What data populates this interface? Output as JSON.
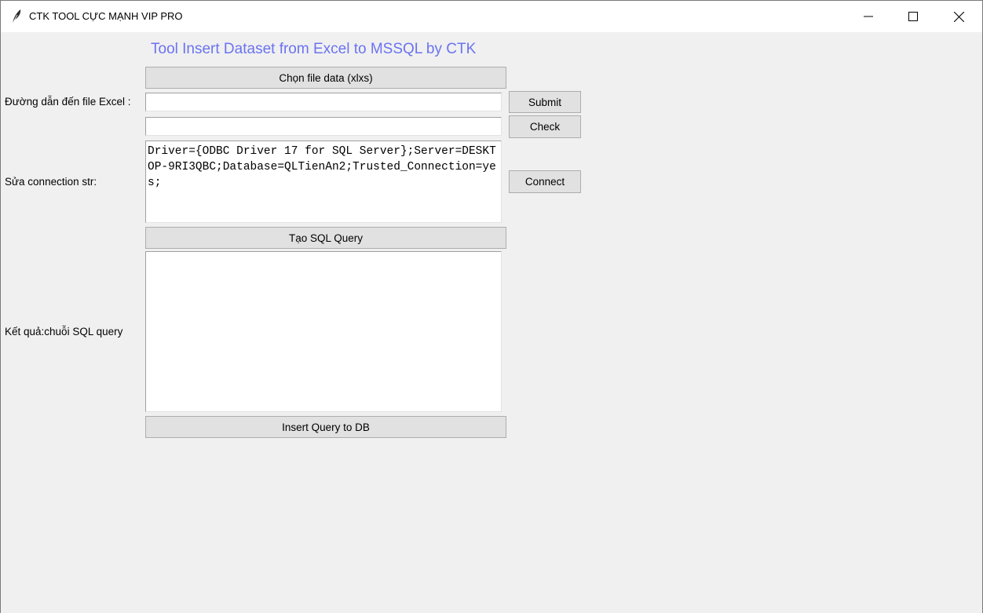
{
  "window": {
    "title": "CTK TOOL CỰC MẠNH VIP PRO",
    "icon": "feather-icon",
    "controls": {
      "minimize_icon": "minimize-icon",
      "maximize_icon": "maximize-icon",
      "close_icon": "close-icon"
    }
  },
  "header": {
    "title": "Tool Insert Dataset from Excel to MSSQL by CTK",
    "color": "#6b73f0"
  },
  "form": {
    "choose_file_button": "Chọn file data (xlxs)",
    "excel_path_label": "Đường dẫn đến file Excel :",
    "excel_path_value": "",
    "submit_button": "Submit",
    "check_value": "",
    "check_button": "Check",
    "connection_label": "Sửa connection str:",
    "connection_value": "Driver={ODBC Driver 17 for SQL Server};Server=DESKTOP-9RI3QBC;Database=QLTienAn2;Trusted_Connection=yes;",
    "connect_button": "Connect",
    "create_query_button": "Tạo SQL Query",
    "result_label": "Kết quả:chuỗi SQL query",
    "result_value": "",
    "insert_button": "Insert Query to DB"
  }
}
